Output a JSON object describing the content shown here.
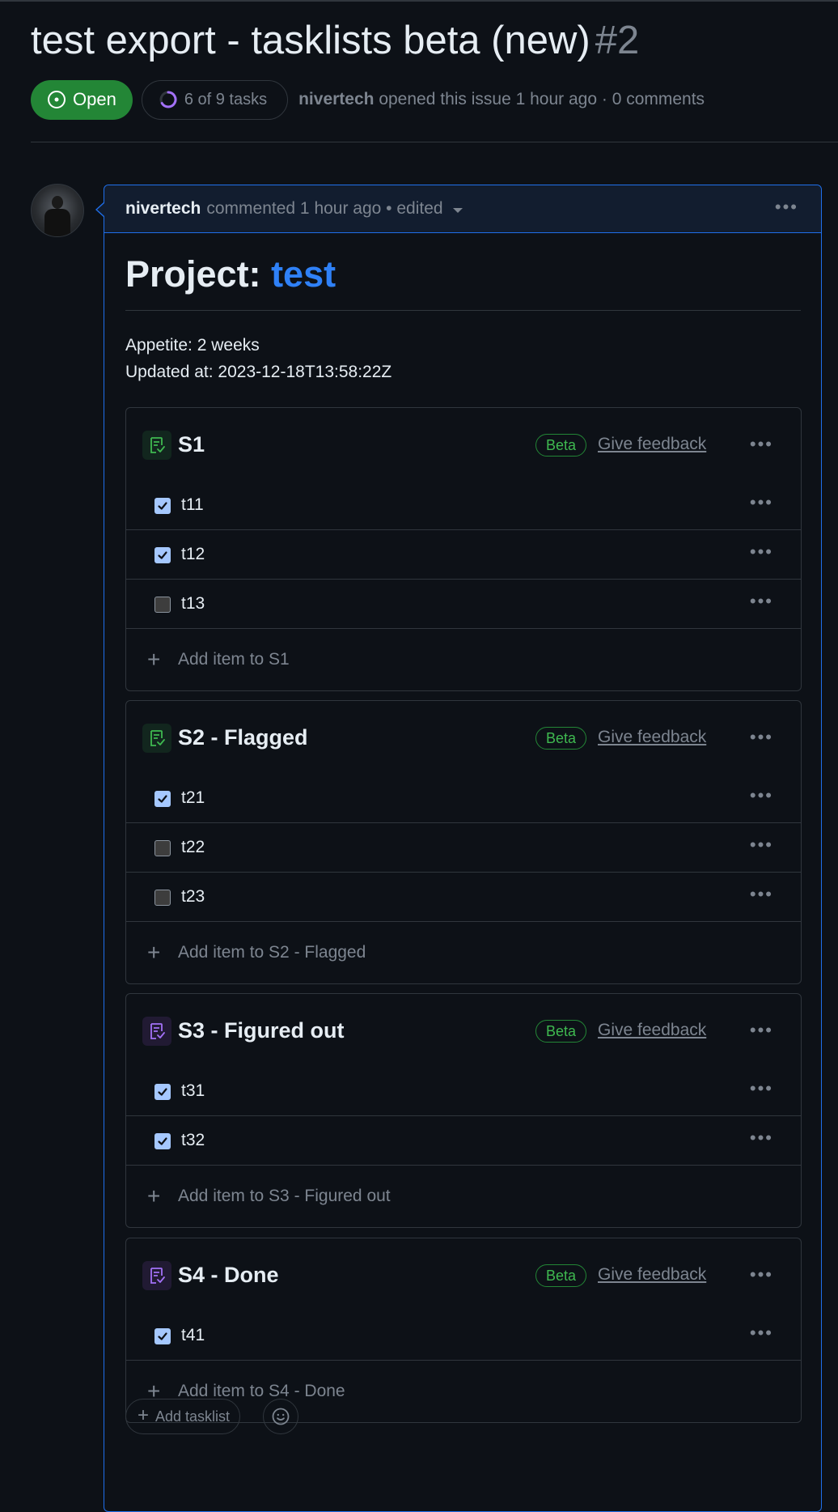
{
  "issue": {
    "title": "test export - tasklists beta (new)",
    "number": "#2",
    "state": "Open",
    "tasks_progress": "6 of 9 tasks",
    "author": "nivertech",
    "opened_text": "opened this issue 1 hour ago · 0 comments"
  },
  "comment": {
    "author": "nivertech",
    "meta": "commented 1 hour ago • edited",
    "heading_prefix": "Project:",
    "heading_link": "test",
    "appetite": "Appetite: 2 weeks",
    "updated": "Updated at: 2023-12-18T13:58:22Z"
  },
  "tasklists": [
    {
      "title": "S1",
      "icon_color": "green",
      "beta": "Beta",
      "feedback": "Give feedback",
      "items": [
        {
          "label": "t11",
          "checked": true
        },
        {
          "label": "t12",
          "checked": true
        },
        {
          "label": "t13",
          "checked": false
        }
      ],
      "add_label": "Add item to S1"
    },
    {
      "title": "S2 - Flagged",
      "icon_color": "green",
      "beta": "Beta",
      "feedback": "Give feedback",
      "items": [
        {
          "label": "t21",
          "checked": true
        },
        {
          "label": "t22",
          "checked": false
        },
        {
          "label": "t23",
          "checked": false
        }
      ],
      "add_label": "Add item to S2 - Flagged"
    },
    {
      "title": "S3 - Figured out",
      "icon_color": "purple",
      "beta": "Beta",
      "feedback": "Give feedback",
      "items": [
        {
          "label": "t31",
          "checked": true
        },
        {
          "label": "t32",
          "checked": true
        }
      ],
      "add_label": "Add item to S3 - Figured out"
    },
    {
      "title": "S4 - Done",
      "icon_color": "purple",
      "beta": "Beta",
      "feedback": "Give feedback",
      "items": [
        {
          "label": "t41",
          "checked": true
        }
      ],
      "add_label": "Add item to S4 - Done"
    }
  ],
  "footer": {
    "add_tasklist": "Add tasklist"
  },
  "colors": {
    "background": "#0d1117",
    "open_green": "#238636",
    "link_blue": "#2f81f7",
    "checkbox_checked": "#a5c8ff",
    "icon_green": "#3fb950",
    "icon_purple": "#a371f7"
  },
  "icons": [
    "issue-open-icon",
    "progress-ring-icon",
    "tasklist-icon",
    "kebab-menu-icon",
    "plus-icon",
    "smiley-icon",
    "caret-down-icon"
  ]
}
